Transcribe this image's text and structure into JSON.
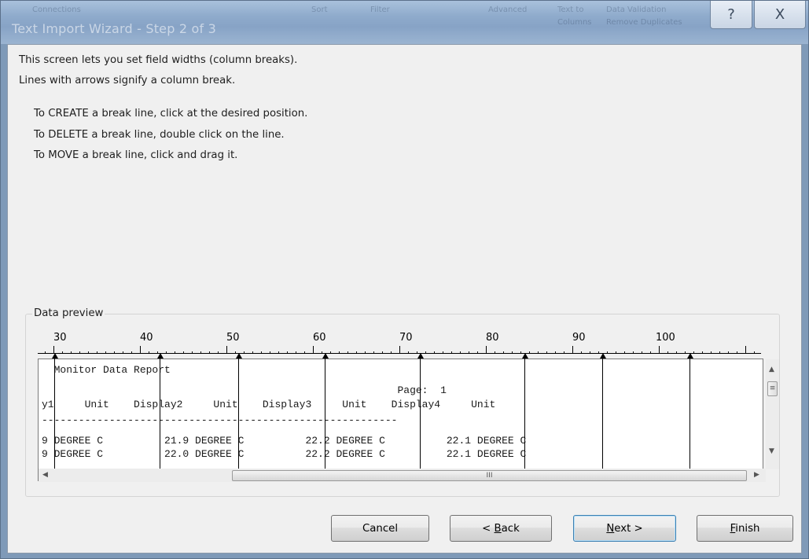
{
  "window": {
    "title": "Text Import Wizard - Step 2 of 3",
    "help_glyph": "?",
    "close_glyph": "X"
  },
  "background_ribbon": [
    "Connections",
    "Sort",
    "Filter",
    "Advanced",
    "Text to",
    "Columns",
    "Remove Duplicates",
    "Data Validation"
  ],
  "instructions": {
    "line1": "This screen lets you set field widths (column breaks).",
    "line2": "Lines with arrows signify a column break.",
    "create": "To CREATE a break line, click at the desired position.",
    "delete": "To DELETE a break line, double click on the line.",
    "move": "To MOVE a break line, click and drag it."
  },
  "preview": {
    "group_label": "Data preview",
    "ruler_numbers": [
      "30",
      "40",
      "50",
      "60",
      "70",
      "80",
      "90",
      "100"
    ],
    "rows": [
      "  Monitor Data Report",
      "                                                          Page:  1",
      "y1     Unit    Display2     Unit    Display3     Unit    Display4     Unit",
      "----------------------------------------------------------",
      "9 DEGREE C          21.9 DEGREE C          22.2 DEGREE C          22.1 DEGREE C",
      "9 DEGREE C          22.0 DEGREE C          22.2 DEGREE C          22.1 DEGREE C"
    ],
    "scroll": {
      "up": "▲",
      "down": "▼",
      "left": "◀",
      "right": "▶",
      "grip_v": "≡",
      "grip_h": "III"
    }
  },
  "buttons": {
    "cancel": "Cancel",
    "back_prefix": "< ",
    "back_key": "B",
    "back_rest": "ack",
    "next_key": "N",
    "next_rest": "ext >",
    "finish_key": "F",
    "finish_rest": "inish"
  }
}
